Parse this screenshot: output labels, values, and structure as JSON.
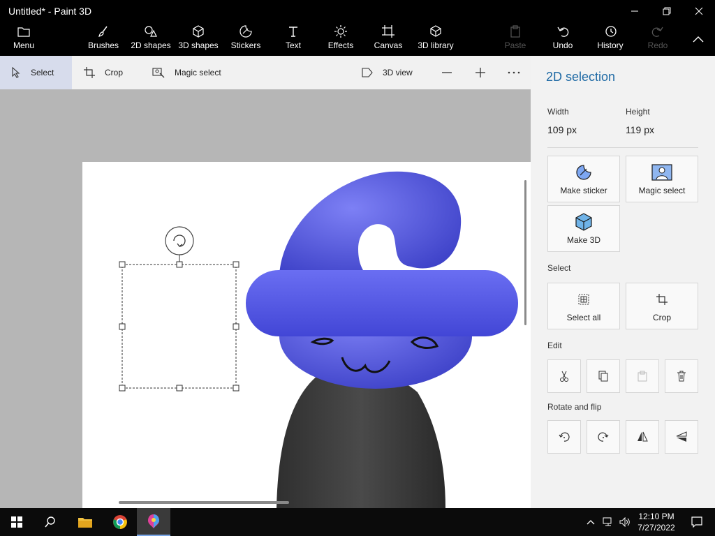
{
  "window": {
    "title": "Untitled* - Paint 3D"
  },
  "toolbar": {
    "menu": "Menu",
    "brushes": "Brushes",
    "shapes2d": "2D shapes",
    "shapes3d": "3D shapes",
    "stickers": "Stickers",
    "text": "Text",
    "effects": "Effects",
    "canvas": "Canvas",
    "library3d": "3D library",
    "paste": "Paste",
    "undo": "Undo",
    "history": "History",
    "redo": "Redo"
  },
  "subbar": {
    "select": "Select",
    "crop": "Crop",
    "magic_select": "Magic select",
    "view3d": "3D view"
  },
  "panel": {
    "title": "2D selection",
    "width_label": "Width",
    "width_value": "109 px",
    "height_label": "Height",
    "height_value": "119 px",
    "make_sticker": "Make sticker",
    "magic_select": "Magic select",
    "make_3d": "Make 3D",
    "select_section": "Select",
    "select_all": "Select all",
    "crop": "Crop",
    "edit_section": "Edit",
    "rotate_section": "Rotate and flip"
  },
  "taskbar": {
    "time": "12:10 PM",
    "date": "7/27/2022"
  },
  "colors": {
    "accent": "#1f6aa5",
    "blob": "#5a5ee8",
    "body": "#3b3b3b"
  }
}
